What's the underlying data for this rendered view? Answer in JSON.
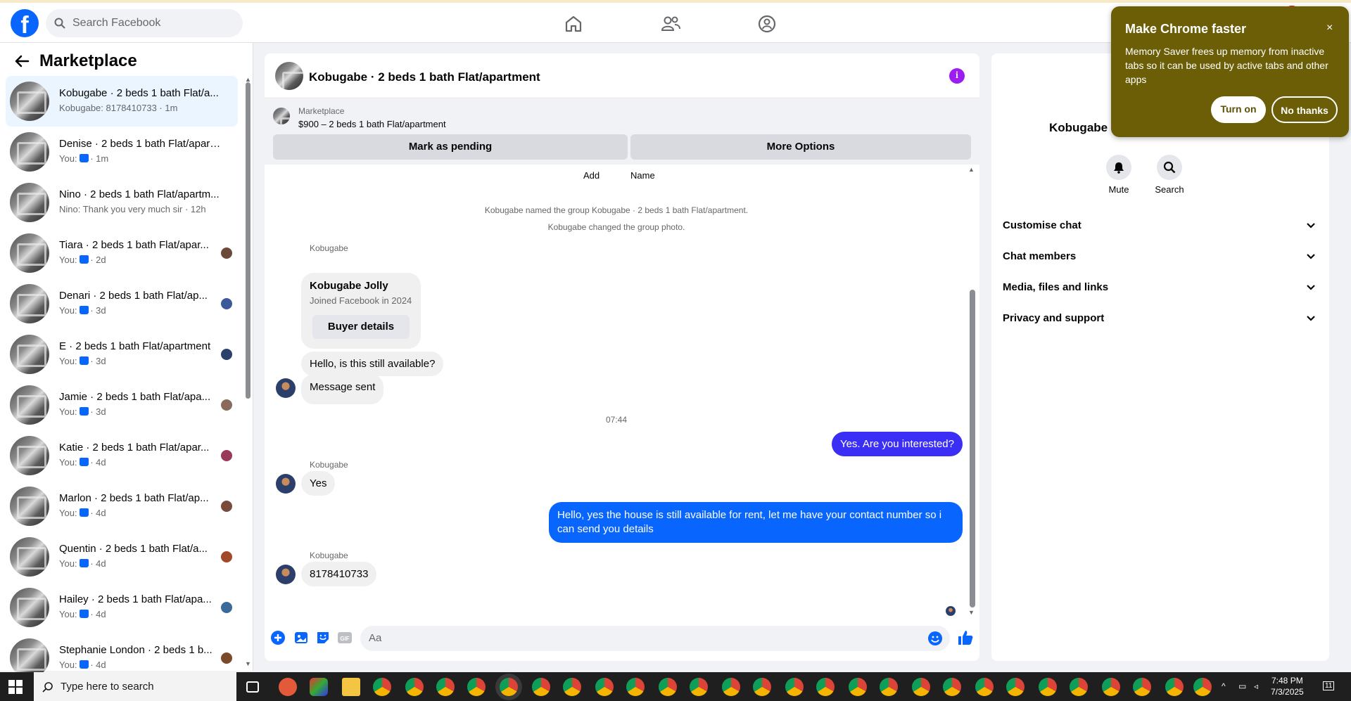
{
  "search": {
    "placeholder": "Search Facebook"
  },
  "sidebar": {
    "title": "Marketplace",
    "conversations": [
      {
        "name": "Kobugabe · 2 beds 1 bath Flat/a...",
        "sub": "Kobugabe: 8178410733 · 1m"
      },
      {
        "name": "Denise · 2 beds 1 bath Flat/apart...",
        "sub": "You:",
        "time": "· 1m"
      },
      {
        "name": "Nino · 2 beds 1 bath Flat/apartm...",
        "sub": "Nino: Thank you very much sir · 12h"
      },
      {
        "name": "Tiara · 2 beds 1 bath Flat/apar...",
        "sub": "You:",
        "time": "· 2d"
      },
      {
        "name": "Denari · 2 beds 1 bath Flat/ap...",
        "sub": "You:",
        "time": "· 3d"
      },
      {
        "name": "E · 2 beds 1 bath Flat/apartment",
        "sub": "You:",
        "time": "· 3d"
      },
      {
        "name": "Jamie · 2 beds 1 bath Flat/apa...",
        "sub": "You:",
        "time": "· 3d"
      },
      {
        "name": "Katie · 2 beds 1 bath Flat/apar...",
        "sub": "You:",
        "time": "· 4d"
      },
      {
        "name": "Marlon · 2 beds 1 bath Flat/ap...",
        "sub": "You:",
        "time": "· 4d"
      },
      {
        "name": "Quentin · 2 beds 1 bath Flat/a...",
        "sub": "You:",
        "time": "· 4d"
      },
      {
        "name": "Hailey · 2 beds 1 bath Flat/apa...",
        "sub": "You:",
        "time": "· 4d"
      },
      {
        "name": "Stephanie London · 2 beds 1 b...",
        "sub": "You:",
        "time": "· 4d"
      }
    ]
  },
  "chat": {
    "title": "Kobugabe · 2 beds 1 bath Flat/apartment",
    "marketplace_label": "Marketplace",
    "listing": "$900 – 2 beds 1 bath Flat/apartment",
    "btn_pending": "Mark as pending",
    "btn_more": "More Options",
    "add_label": "Add",
    "name_label": "Name",
    "sys1": "Kobugabe named the group Kobugabe · 2 beds 1 bath Flat/apartment.",
    "sys2": "Kobugabe changed the group photo.",
    "sender": "Kobugabe",
    "card_name": "Kobugabe Jolly",
    "card_sub": "Joined Facebook in 2024",
    "card_btn": "Buyer details",
    "msg1": "Hello, is this still available?",
    "msg2": "Message sent",
    "time_sep": "07:44",
    "msg3": "Yes. Are you interested?",
    "msg4": "Yes",
    "msg5": "Hello, yes the house is still available for rent, let me have your contact number so i can send you details",
    "msg6": "8178410733",
    "composer_placeholder": "Aa"
  },
  "right_panel": {
    "name": "Kobugabe ·",
    "mute": "Mute",
    "search": "Search",
    "rows": [
      "Customise chat",
      "Chat members",
      "Media, files and links",
      "Privacy and support"
    ]
  },
  "chrome_popup": {
    "title": "Make Chrome faster",
    "close": "×",
    "body": "Memory Saver frees up memory from inactive tabs so it can be used by active tabs and other apps",
    "turn_on": "Turn on",
    "no_thanks": "No thanks"
  },
  "taskbar": {
    "search_placeholder": "Type here to search",
    "time": "7:48 PM",
    "date": "7/3/2025",
    "notif_count": "11"
  },
  "colors": {
    "brand": "#0866ff",
    "outgoing": "#0866ff",
    "info": "#9c1cf2",
    "chrome_popup": "#6b5e06"
  }
}
